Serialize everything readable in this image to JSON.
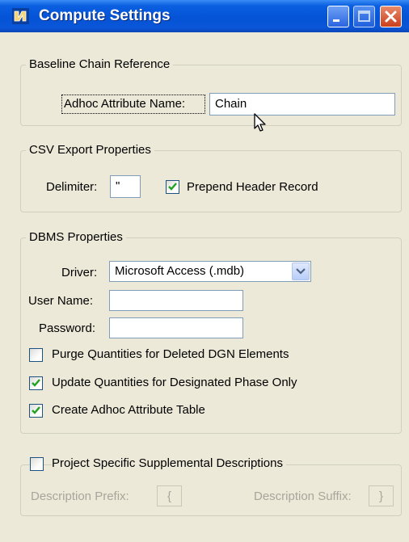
{
  "window": {
    "title": "Compute Settings",
    "controls": {
      "minimize": "minimize-icon",
      "maximize": "maximize-icon",
      "close": "close-icon"
    }
  },
  "baseline": {
    "legend": "Baseline Chain Reference",
    "adhoc_label": "Adhoc Attribute Name:",
    "adhoc_value": "Chain"
  },
  "csv": {
    "legend": "CSV Export Properties",
    "delimiter_label": "Delimiter:",
    "delimiter_value": "\"",
    "prepend_label": "Prepend Header Record",
    "prepend_checked": true
  },
  "dbms": {
    "legend": "DBMS Properties",
    "driver_label": "Driver:",
    "driver_value": "Microsoft Access (.mdb)",
    "username_label": "User Name:",
    "username_value": "",
    "password_label": "Password:",
    "password_value": "",
    "options": [
      {
        "label": "Purge Quantities for Deleted DGN Elements",
        "checked": false
      },
      {
        "label": "Update Quantities for Designated Phase Only",
        "checked": true
      },
      {
        "label": "Create Adhoc Attribute Table",
        "checked": true
      }
    ]
  },
  "project": {
    "legend": "Project Specific Supplemental Descriptions",
    "checked": false,
    "prefix_label": "Description Prefix:",
    "prefix_value": "{",
    "suffix_label": "Description Suffix:",
    "suffix_value": "}"
  },
  "colors": {
    "titlebar": "#0553d6",
    "window_bg": "#ece9d8",
    "check_mark": "#21a121",
    "disabled_text": "#a7a69a"
  }
}
